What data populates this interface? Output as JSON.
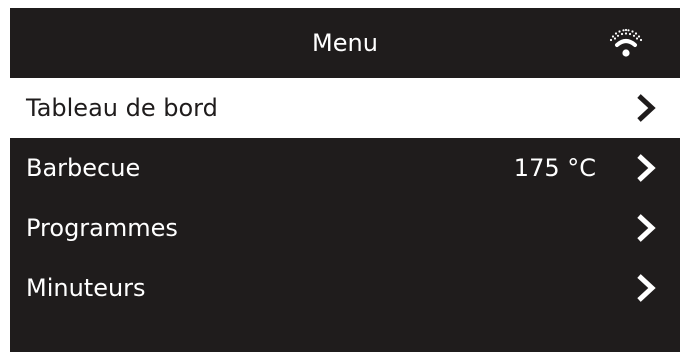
{
  "header": {
    "title": "Menu",
    "status_icon": "wifi-icon"
  },
  "colors": {
    "background": "#1f1c1c",
    "text": "#ffffff",
    "selected_background": "#ffffff",
    "selected_text": "#1f1c1c"
  },
  "menu": {
    "items": [
      {
        "label": "Tableau de bord",
        "value": "",
        "icon": "chevron-right-icon",
        "selected": true
      },
      {
        "label": "Barbecue",
        "value": "175 °C",
        "icon": "chevron-right-icon",
        "selected": false
      },
      {
        "label": "Programmes",
        "value": "",
        "icon": "chevron-right-icon",
        "selected": false
      },
      {
        "label": "Minuteurs",
        "value": "",
        "icon": "chevron-right-icon",
        "selected": false
      }
    ]
  }
}
